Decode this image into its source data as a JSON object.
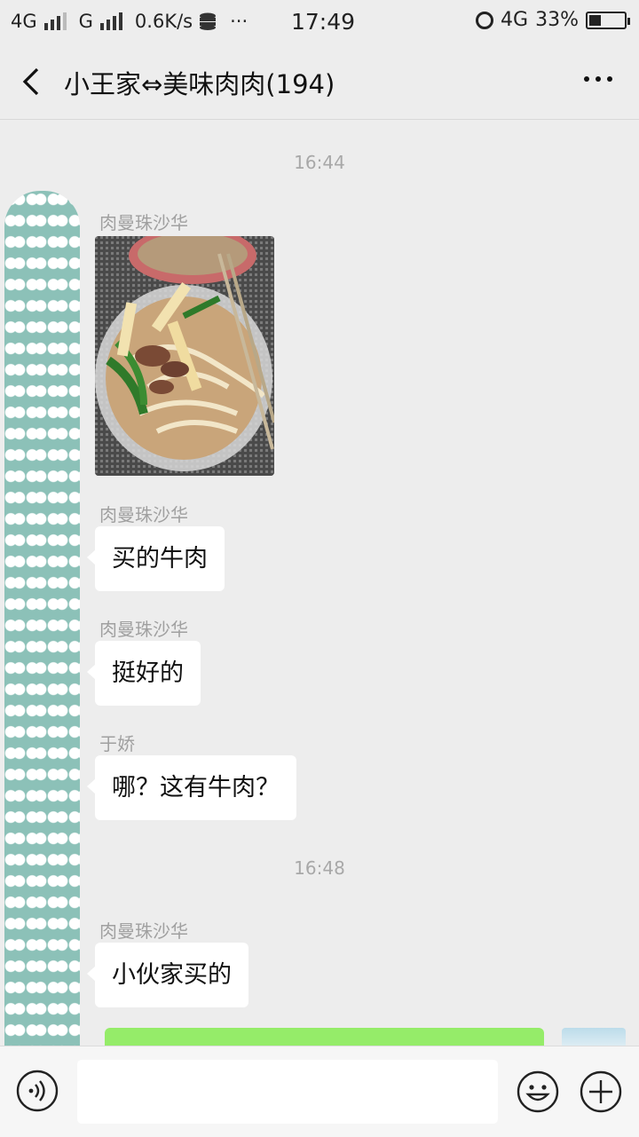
{
  "status_bar": {
    "network1": "4G",
    "network2": "G",
    "speed": "0.6K/s",
    "dots": "···",
    "time": "17:49",
    "network3": "4G",
    "battery_text": "33%",
    "battery_level": 0.33
  },
  "header": {
    "title": "小王家⇔美味肉肉(194)"
  },
  "messages": {
    "time1": "16:44",
    "m1_sender": "肉曼珠沙华",
    "m2_sender": "肉曼珠沙华",
    "m2_text": "买的牛肉",
    "m3_sender": "肉曼珠沙华",
    "m3_text": "挺好的",
    "m4_sender": "于娇",
    "m4_text": "哪？这有牛肉？",
    "time2": "16:48",
    "m5_sender": "肉曼珠沙华",
    "m5_text": "小伙家买的"
  },
  "colors": {
    "background": "#ededed",
    "bubble": "#ffffff",
    "self_bubble": "#95ec69",
    "avatar": "#8cc1b8"
  },
  "icons": [
    "back-icon",
    "more-icon",
    "voice-icon",
    "emoji-icon",
    "plus-icon",
    "alarm-icon",
    "battery-icon",
    "signal-icon",
    "database-icon"
  ]
}
